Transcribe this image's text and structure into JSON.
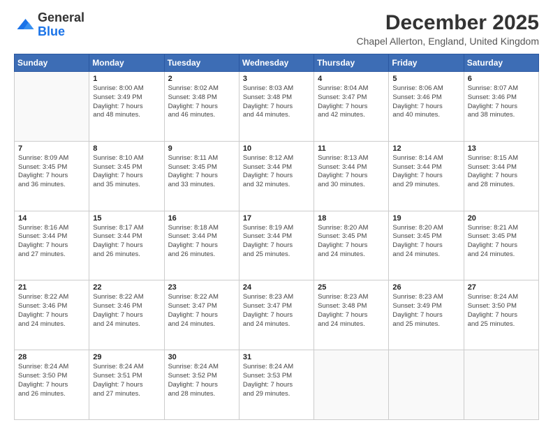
{
  "header": {
    "logo_general": "General",
    "logo_blue": "Blue",
    "month_title": "December 2025",
    "location": "Chapel Allerton, England, United Kingdom"
  },
  "weekdays": [
    "Sunday",
    "Monday",
    "Tuesday",
    "Wednesday",
    "Thursday",
    "Friday",
    "Saturday"
  ],
  "weeks": [
    [
      {
        "day": "",
        "info": ""
      },
      {
        "day": "1",
        "info": "Sunrise: 8:00 AM\nSunset: 3:49 PM\nDaylight: 7 hours\nand 48 minutes."
      },
      {
        "day": "2",
        "info": "Sunrise: 8:02 AM\nSunset: 3:48 PM\nDaylight: 7 hours\nand 46 minutes."
      },
      {
        "day": "3",
        "info": "Sunrise: 8:03 AM\nSunset: 3:48 PM\nDaylight: 7 hours\nand 44 minutes."
      },
      {
        "day": "4",
        "info": "Sunrise: 8:04 AM\nSunset: 3:47 PM\nDaylight: 7 hours\nand 42 minutes."
      },
      {
        "day": "5",
        "info": "Sunrise: 8:06 AM\nSunset: 3:46 PM\nDaylight: 7 hours\nand 40 minutes."
      },
      {
        "day": "6",
        "info": "Sunrise: 8:07 AM\nSunset: 3:46 PM\nDaylight: 7 hours\nand 38 minutes."
      }
    ],
    [
      {
        "day": "7",
        "info": "Sunrise: 8:09 AM\nSunset: 3:45 PM\nDaylight: 7 hours\nand 36 minutes."
      },
      {
        "day": "8",
        "info": "Sunrise: 8:10 AM\nSunset: 3:45 PM\nDaylight: 7 hours\nand 35 minutes."
      },
      {
        "day": "9",
        "info": "Sunrise: 8:11 AM\nSunset: 3:45 PM\nDaylight: 7 hours\nand 33 minutes."
      },
      {
        "day": "10",
        "info": "Sunrise: 8:12 AM\nSunset: 3:44 PM\nDaylight: 7 hours\nand 32 minutes."
      },
      {
        "day": "11",
        "info": "Sunrise: 8:13 AM\nSunset: 3:44 PM\nDaylight: 7 hours\nand 30 minutes."
      },
      {
        "day": "12",
        "info": "Sunrise: 8:14 AM\nSunset: 3:44 PM\nDaylight: 7 hours\nand 29 minutes."
      },
      {
        "day": "13",
        "info": "Sunrise: 8:15 AM\nSunset: 3:44 PM\nDaylight: 7 hours\nand 28 minutes."
      }
    ],
    [
      {
        "day": "14",
        "info": "Sunrise: 8:16 AM\nSunset: 3:44 PM\nDaylight: 7 hours\nand 27 minutes."
      },
      {
        "day": "15",
        "info": "Sunrise: 8:17 AM\nSunset: 3:44 PM\nDaylight: 7 hours\nand 26 minutes."
      },
      {
        "day": "16",
        "info": "Sunrise: 8:18 AM\nSunset: 3:44 PM\nDaylight: 7 hours\nand 26 minutes."
      },
      {
        "day": "17",
        "info": "Sunrise: 8:19 AM\nSunset: 3:44 PM\nDaylight: 7 hours\nand 25 minutes."
      },
      {
        "day": "18",
        "info": "Sunrise: 8:20 AM\nSunset: 3:45 PM\nDaylight: 7 hours\nand 24 minutes."
      },
      {
        "day": "19",
        "info": "Sunrise: 8:20 AM\nSunset: 3:45 PM\nDaylight: 7 hours\nand 24 minutes."
      },
      {
        "day": "20",
        "info": "Sunrise: 8:21 AM\nSunset: 3:45 PM\nDaylight: 7 hours\nand 24 minutes."
      }
    ],
    [
      {
        "day": "21",
        "info": "Sunrise: 8:22 AM\nSunset: 3:46 PM\nDaylight: 7 hours\nand 24 minutes."
      },
      {
        "day": "22",
        "info": "Sunrise: 8:22 AM\nSunset: 3:46 PM\nDaylight: 7 hours\nand 24 minutes."
      },
      {
        "day": "23",
        "info": "Sunrise: 8:22 AM\nSunset: 3:47 PM\nDaylight: 7 hours\nand 24 minutes."
      },
      {
        "day": "24",
        "info": "Sunrise: 8:23 AM\nSunset: 3:47 PM\nDaylight: 7 hours\nand 24 minutes."
      },
      {
        "day": "25",
        "info": "Sunrise: 8:23 AM\nSunset: 3:48 PM\nDaylight: 7 hours\nand 24 minutes."
      },
      {
        "day": "26",
        "info": "Sunrise: 8:23 AM\nSunset: 3:49 PM\nDaylight: 7 hours\nand 25 minutes."
      },
      {
        "day": "27",
        "info": "Sunrise: 8:24 AM\nSunset: 3:50 PM\nDaylight: 7 hours\nand 25 minutes."
      }
    ],
    [
      {
        "day": "28",
        "info": "Sunrise: 8:24 AM\nSunset: 3:50 PM\nDaylight: 7 hours\nand 26 minutes."
      },
      {
        "day": "29",
        "info": "Sunrise: 8:24 AM\nSunset: 3:51 PM\nDaylight: 7 hours\nand 27 minutes."
      },
      {
        "day": "30",
        "info": "Sunrise: 8:24 AM\nSunset: 3:52 PM\nDaylight: 7 hours\nand 28 minutes."
      },
      {
        "day": "31",
        "info": "Sunrise: 8:24 AM\nSunset: 3:53 PM\nDaylight: 7 hours\nand 29 minutes."
      },
      {
        "day": "",
        "info": ""
      },
      {
        "day": "",
        "info": ""
      },
      {
        "day": "",
        "info": ""
      }
    ]
  ]
}
